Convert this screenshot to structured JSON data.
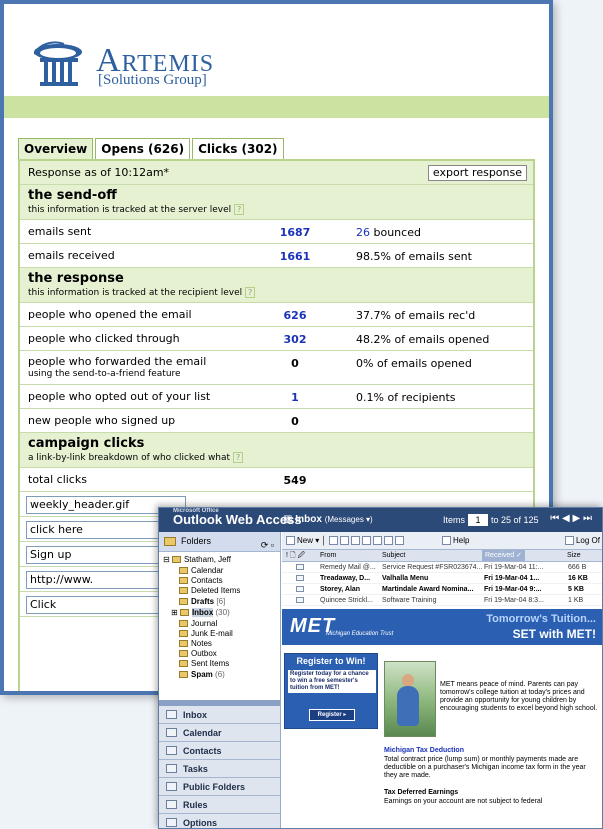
{
  "report": {
    "brand": {
      "name_initial": "A",
      "name_rest": "RTEMIS",
      "subtitle": "[Solutions Group]"
    },
    "tabs": [
      "Overview",
      "Opens (626)",
      "Clicks (302)"
    ],
    "response_as_of": "Response as of 10:12am*",
    "export_label": "export response",
    "sendoff": {
      "title": "the send-off",
      "subtitle": "this information is tracked at the server level",
      "rows": [
        {
          "label": "emails sent",
          "value": "1687",
          "pct_num": "26",
          "pct_text": " bounced"
        },
        {
          "label": "emails received",
          "value": "1661",
          "pct_num": "",
          "pct_text": "98.5% of emails sent"
        }
      ]
    },
    "response": {
      "title": "the response",
      "subtitle": "this information is tracked at the recipient level",
      "rows": [
        {
          "label": "people who opened the email",
          "value": "626",
          "pct": "37.7% of emails rec'd"
        },
        {
          "label": "people who clicked through",
          "value": "302",
          "pct": "48.2% of emails opened"
        },
        {
          "label": "people who forwarded the email",
          "sublabel": "using the send-to-a-friend feature",
          "value": "0",
          "pct": "0% of emails opened"
        },
        {
          "label": "people who opted out of your list",
          "value": "1",
          "pct": "0.1% of recipients"
        },
        {
          "label": "new people who signed up",
          "value": "0",
          "pct": ""
        }
      ]
    },
    "campaign": {
      "title": "campaign clicks",
      "subtitle": "a link-by-link breakdown of who clicked what",
      "total_label": "total clicks",
      "total_value": "549",
      "links": [
        "weekly_header.gif",
        "click here",
        "Sign up",
        "http://www.",
        "Click"
      ]
    },
    "qmark": "?"
  },
  "outlook": {
    "app_title": "Outlook Web Access",
    "ms_label": "Microsoft Office",
    "inbox_label": "Inbox",
    "inbox_sub": "(Messages ▾)",
    "items_label": "Items",
    "items_page": "1",
    "items_range": "to 25 of 125",
    "nav_glyphs": "⏮ ◀ ▶ ⏭",
    "folders_label": "Folders",
    "tree": {
      "user": "Statham, Jeff",
      "calendar": "Calendar",
      "contacts": "Contacts",
      "deleted": "Deleted Items",
      "drafts": "Drafts",
      "drafts_count": "[6]",
      "inbox": "Inbox",
      "inbox_count": "(30)",
      "journal": "Journal",
      "junk": "Junk E-mail",
      "notes": "Notes",
      "outbox": "Outbox",
      "sent": "Sent Items",
      "spam": "Spam",
      "spam_count": "(6)"
    },
    "nav_buttons": [
      "Inbox",
      "Calendar",
      "Contacts",
      "Tasks",
      "Public Folders",
      "Rules",
      "Options"
    ],
    "toolbar": {
      "new_label": "New ▾",
      "help_label": "Help",
      "logoff_label": "Log Of"
    },
    "columns": {
      "flags": "! 🗋 🖉",
      "from": "From",
      "subject": "Subject",
      "received": "Received ✓",
      "size": "Size"
    },
    "messages": [
      {
        "from": "Remedy Mail @...",
        "subject": "Service Request #FSR023674...",
        "received": "Fri 19-Mar-04 11:...",
        "size": "666 B",
        "unread": false
      },
      {
        "from": "Treadaway, D...",
        "subject": "Valhalla Menu",
        "received": "Fri 19-Mar-04 1...",
        "size": "16 KB",
        "unread": true
      },
      {
        "from": "Storey, Alan",
        "subject": "Martindale Award Nomina...",
        "received": "Fri 19-Mar-04 9:...",
        "size": "5 KB",
        "unread": true
      },
      {
        "from": "Quincee Strickl...",
        "subject": "Software Training",
        "received": "Fri 19-Mar-04 8:3...",
        "size": "1 KB",
        "unread": false
      }
    ],
    "preview": {
      "logo": "MET",
      "trust": "Michigan Education Trust",
      "tagline1": "Tomorrow's Tuition...",
      "tagline2": "SET with MET!",
      "register_title": "Register to Win!",
      "register_text": "Register today for a chance to win a free semester's tuition from MET!",
      "register_button": "Register ▸",
      "copy": "MET means peace of mind. Parents can pay tomorrow's college tuition at today's prices and provide an opportunity for young children by encouraging students to excel beyond high school.",
      "h1": "Michigan Tax Deduction",
      "p1": "Total contract price (lump sum) or monthly payments made are deductible on a purchaser's Michigan income tax form in the year they are made.",
      "h2": "Tax Deferred Earnings",
      "p2": "Earnings on your account are not subject to federal"
    }
  }
}
